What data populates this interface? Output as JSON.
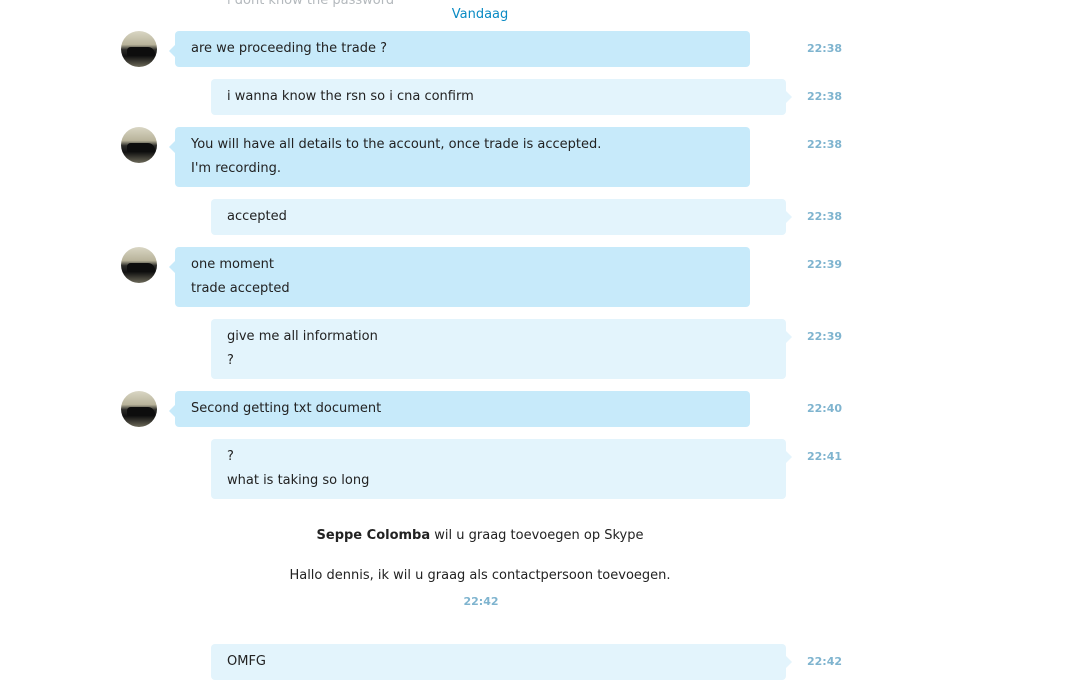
{
  "partial_top": {
    "text": "i dont know the password"
  },
  "date_separator": "Vandaag",
  "messages": [
    {
      "direction": "in",
      "lines": [
        "are we proceeding the trade ?"
      ],
      "time": "22:38"
    },
    {
      "direction": "out",
      "lines": [
        "i wanna know the rsn so i cna confirm"
      ],
      "time": "22:38"
    },
    {
      "direction": "in",
      "lines": [
        "You will have all details to the account, once trade is accepted.",
        "I'm recording."
      ],
      "time": "22:38"
    },
    {
      "direction": "out",
      "lines": [
        "accepted"
      ],
      "time": "22:38"
    },
    {
      "direction": "in",
      "lines": [
        "one moment",
        "trade accepted"
      ],
      "time": "22:39"
    },
    {
      "direction": "out",
      "lines": [
        "give me all information",
        "?"
      ],
      "time": "22:39"
    },
    {
      "direction": "in",
      "lines": [
        "Second getting txt document"
      ],
      "time": "22:40"
    },
    {
      "direction": "out",
      "lines": [
        "?",
        "what is taking so long"
      ],
      "time": "22:41"
    }
  ],
  "contact_request": {
    "sender": "Seppe Colomba",
    "action": "wil u graag toevoegen op Skype",
    "message": "Hallo dennis, ik wil u graag als contactpersoon toevoegen.",
    "time": "22:42"
  },
  "last_message": {
    "direction": "out",
    "lines": [
      "OMFG"
    ],
    "time": "22:42"
  }
}
